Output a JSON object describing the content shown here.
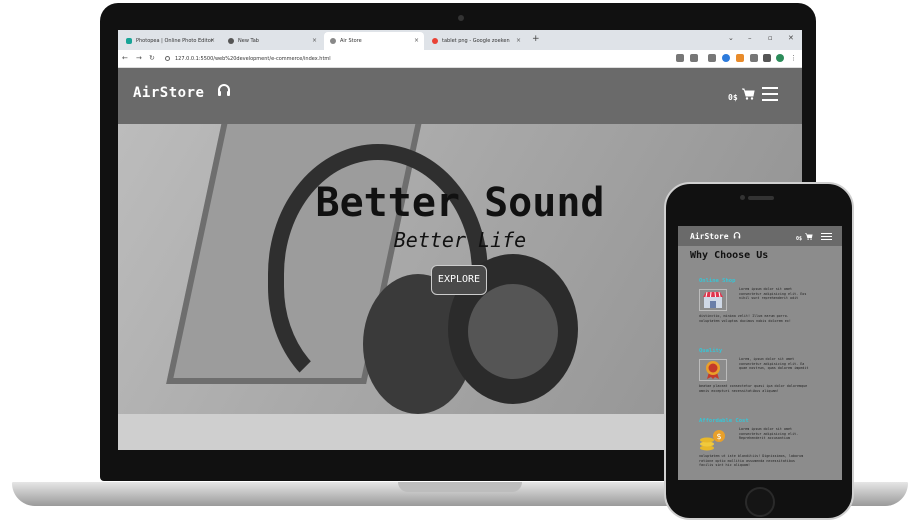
{
  "browser": {
    "tabs": [
      {
        "label": "Photopea | Online Photo Editor",
        "icon": "photopea-icon",
        "active": false
      },
      {
        "label": "New Tab",
        "icon": "chrome-icon",
        "active": false
      },
      {
        "label": "Air Store",
        "icon": "globe-icon",
        "active": true
      },
      {
        "label": "tablet png - Google zoeken",
        "icon": "google-icon",
        "active": false
      }
    ],
    "new_tab": "+",
    "url": "127.0.0.1:5500/web%20development/e-commerce/index.html"
  },
  "site": {
    "brand": "AirStore",
    "cart_count": "0$",
    "hero_title": "Better Sound",
    "hero_subtitle": "Better Life",
    "explore_label": "EXPLORE"
  },
  "mobile": {
    "brand": "AirStore",
    "cart_count": "0$",
    "section_title": "Why Choose Us",
    "features": [
      {
        "title": "Online Shop",
        "icon": "store-icon",
        "side_text": "Lorem ipsum dolor sit amet consectetur adipisicing elit. Eos nihil sunt reprehenderit odit",
        "bottom_text": "distinctio, minima velit! Illum earum porro. voluptatem voluptas ducimus nobis dolorem ex!"
      },
      {
        "title": "Quality",
        "icon": "quality-badge-icon",
        "side_text": "Lorem, ipsum dolor sit amet consectetur adipisicing elit. Ea quae nostrum, quas dolorem impedit",
        "bottom_text": "beatae placeat consectetur quasi ipa dolor doloremque omnis excepturi necessitatibus aliquam!"
      },
      {
        "title": "Affordable Cost",
        "icon": "coins-icon",
        "side_text": "Lorem ipsum dolor sit amet consectetur adipisicing elit. Reprehenderit accusantium",
        "bottom_text": "voluptatem ut iste blanditiis! Dignissimos, laborum ratione optio mollitia assumenda necessitatibus facilis sint hic aliquam!"
      }
    ]
  }
}
